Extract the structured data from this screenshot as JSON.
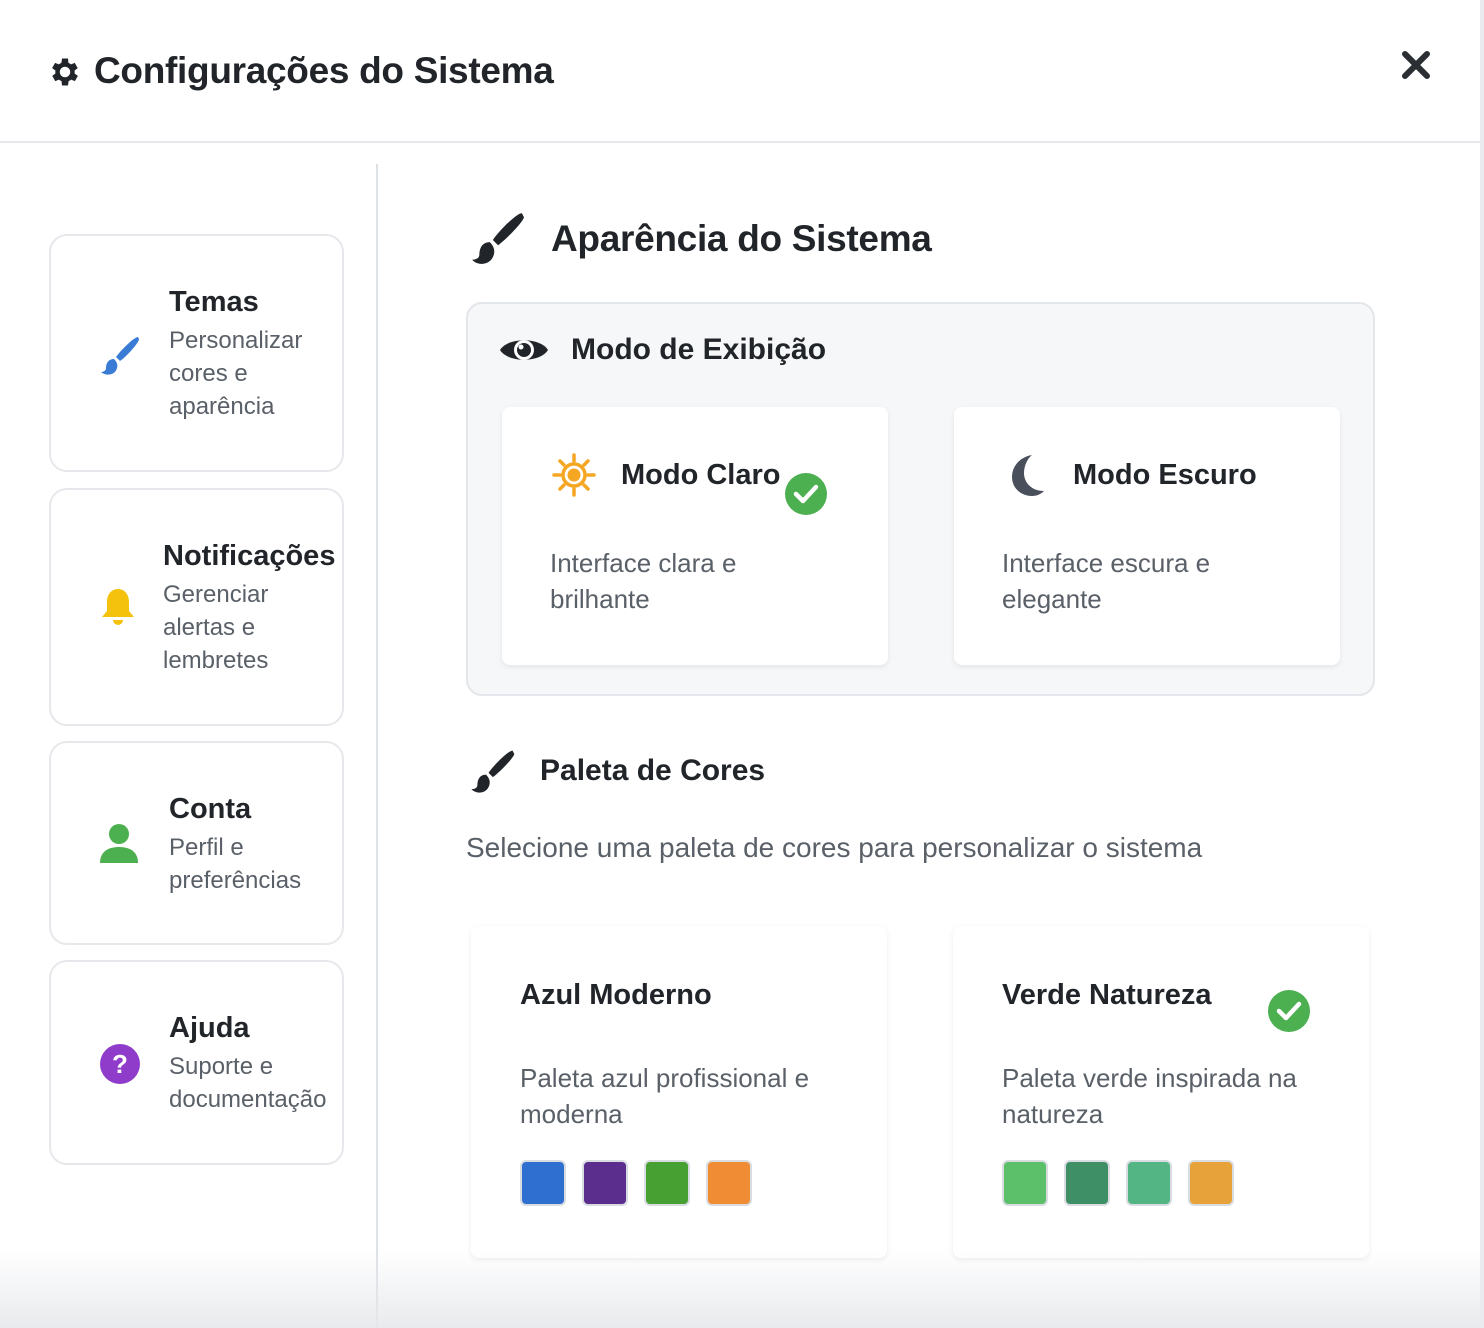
{
  "header": {
    "title": "Configurações do Sistema"
  },
  "sidebar": {
    "items": [
      {
        "title": "Temas",
        "desc": "Personalizar cores e aparência",
        "icon": "paintbrush-icon",
        "color": "#3a7bd5"
      },
      {
        "title": "Notificações",
        "desc": "Gerenciar alertas e lembretes",
        "icon": "bell-icon",
        "color": "#f4c20d"
      },
      {
        "title": "Conta",
        "desc": "Perfil e preferências",
        "icon": "user-icon",
        "color": "#4caf50"
      },
      {
        "title": "Ajuda",
        "desc": "Suporte e documentação",
        "icon": "question-circle-icon",
        "color": "#8e3cc9"
      }
    ]
  },
  "main": {
    "section_title": "Aparência do Sistema",
    "display_mode": {
      "title": "Modo de Exibição",
      "options": [
        {
          "title": "Modo Claro",
          "desc": "Interface clara e brilhante",
          "icon": "sun-icon",
          "selected": true
        },
        {
          "title": "Modo Escuro",
          "desc": "Interface escura e elegante",
          "icon": "moon-icon",
          "selected": false
        }
      ]
    },
    "palette": {
      "title": "Paleta de Cores",
      "hint": "Selecione uma paleta de cores para personalizar o sistema",
      "options": [
        {
          "title": "Azul Moderno",
          "desc": "Paleta azul profissional e moderna",
          "selected": false,
          "colors": [
            "#2f6fd0",
            "#5b2d8c",
            "#46a032",
            "#ef8c34"
          ]
        },
        {
          "title": "Verde Natureza",
          "desc": "Paleta verde inspirada na natureza",
          "selected": true,
          "colors": [
            "#5cc06a",
            "#3f8f66",
            "#52b583",
            "#e8a23a"
          ]
        }
      ]
    }
  },
  "colors": {
    "check": "#4caf50",
    "sun": "#f5a623",
    "moon": "#4a4f5c"
  }
}
